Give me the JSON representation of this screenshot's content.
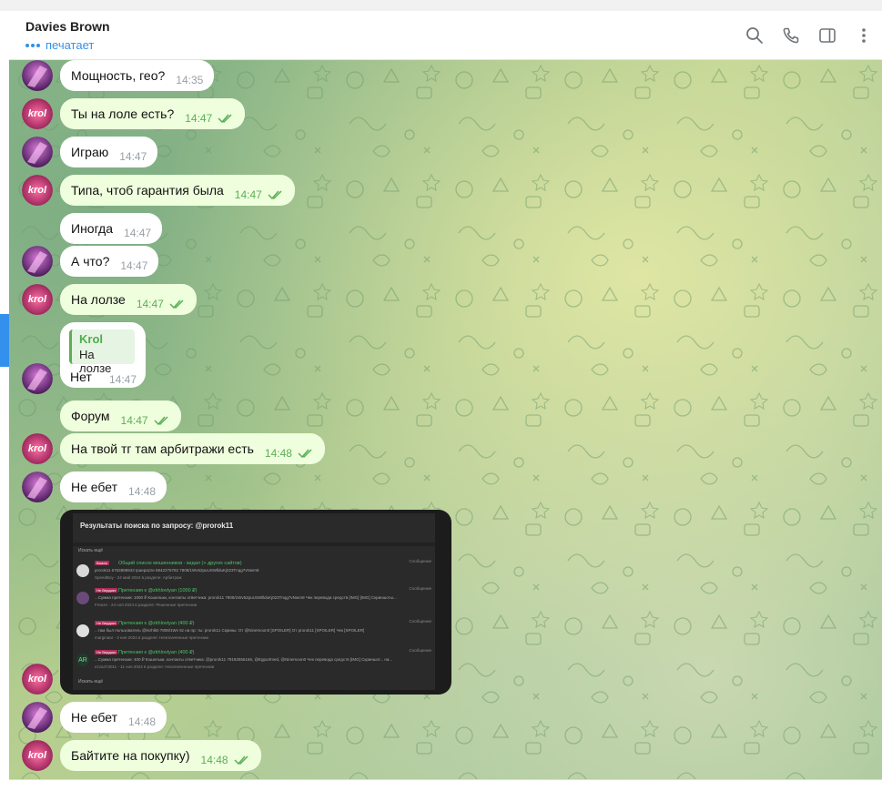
{
  "chat": {
    "contact_name": "Davies Brown",
    "status": "печатает"
  },
  "messages": [
    {
      "text": "Мощность, гео?",
      "time": "14:35",
      "out": false
    },
    {
      "text": "Ты на лоле есть?",
      "time": "14:47",
      "out": true
    },
    {
      "text": "Играю",
      "time": "14:47",
      "out": false
    },
    {
      "text": "Типа, чтоб гарантия была",
      "time": "14:47",
      "out": true
    },
    {
      "text": "Иногда",
      "time": "14:47",
      "out": false
    },
    {
      "text": "А что?",
      "time": "14:47",
      "out": false
    },
    {
      "text": "На лолзе",
      "time": "14:47",
      "out": true
    },
    {
      "text": "Форум",
      "time": "14:47",
      "out": true
    },
    {
      "text": "На твой тг там арбитражи есть",
      "time": "14:48",
      "out": true
    },
    {
      "text": "Не ебет",
      "time": "14:48",
      "out": false
    },
    {
      "text": "Не ебет",
      "time": "14:48",
      "out": false
    },
    {
      "text": "Байтите на покупку)",
      "time": "14:48",
      "out": true
    }
  ],
  "reply_message": {
    "quote_author": "Krol",
    "quote_text": "На лолзе",
    "text": "Нет",
    "time": "14:47"
  },
  "avatars": {
    "krol_label": "krol"
  },
  "screenshot": {
    "title": "Результаты поиска по запросу: @prorok11",
    "sort_label": "Искать ещё",
    "more_label": "Искать ещё",
    "results": [
      {
        "tag": "Важно",
        "title": "Общий список мошенников - кидал (+ других сайтов)",
        "line": "prorok11 6763888943 Ipaepazze 6942276782 7808/1Wv52puUSWllduKj023Tnqg7vNwrn8",
        "meta": "SpeedBuy - 24 май 2024 в разделе: Арбитраж",
        "kind": "Сообщение",
        "icon_color": "#d9d9d9"
      },
      {
        "tag": "Не Вердикт",
        "title": "Претензия к @zkhlovtyan (1000 ₽)",
        "line": "...Сумма претензии: 1000 ₽ Кошельки, контакты ответчика: prorok11 7808/1Wv52puUSWllduKj023Tnqg7vNwrn8 Чек перевода средств [IMG] [IMG] Скриншоты...",
        "meta": "Freeze - 24 ноя 2024 в разделе: Решенные претензии",
        "kind": "Сообщение",
        "icon_color": "#6a4a7a"
      },
      {
        "tag": "Не Вердикт",
        "title": "Претензия к @zkhlovtyan (400 ₽)",
        "line": "...там был пользователь @lezhlk0 7808/1Wv 5z на пр: ты: prorok11 Скрины: От @Ninemoon0 [SPOILER] От prorok11 [SPOILER] Чек [SPOILER]",
        "meta": "marginaar - 3 ноя 2024 в разделе: Неоплаченные претензии",
        "kind": "Сообщение",
        "icon_color": "#e0e0e0"
      },
      {
        "tag": "Не Вердикт",
        "title": "Претензия к @zkhlovtyan (400 ₽)",
        "line": "...Сумма претензии: 400 ₽ Кошельки, контакты ответчика: @prorok11 79192556166, @Egpurtmed, @Ninemoon0 Чек перевода средств [IMG] Скриншот... на...",
        "meta": "ezza473011 - 11 ноя 2024 в разделе: Неоплаченные претензии",
        "kind": "Сообщение",
        "icon_color": "#1f3b2a",
        "icon_text": "AR"
      }
    ]
  }
}
